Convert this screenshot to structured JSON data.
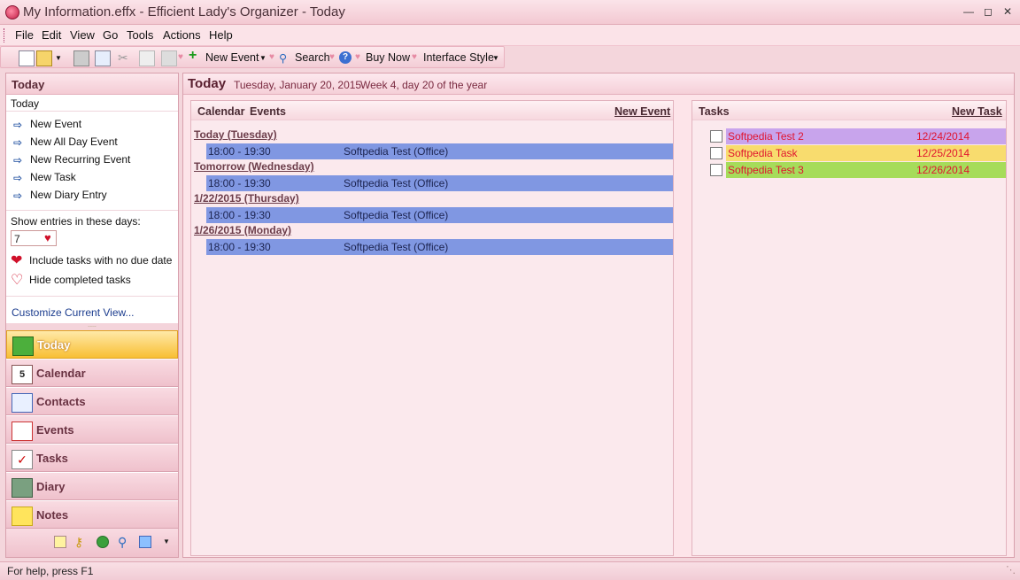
{
  "window": {
    "title": "My Information.effx - Efficient Lady's Organizer - Today"
  },
  "menu": [
    "File",
    "Edit",
    "View",
    "Go",
    "Tools",
    "Actions",
    "Help"
  ],
  "toolbar": {
    "new_event": "New Event",
    "search": "Search",
    "buy_now": "Buy Now",
    "interface_style": "Interface Style"
  },
  "left": {
    "header": "Today",
    "subheader": "Today",
    "actions": [
      "New Event",
      "New All Day Event",
      "New Recurring Event",
      "New Task",
      "New Diary Entry"
    ],
    "show_entries_label": "Show entries in these days:",
    "days_value": "7",
    "include_tasks": "Include tasks with no due date",
    "hide_completed": "Hide completed tasks",
    "customize": "Customize Current View...",
    "nav": [
      "Today",
      "Calendar",
      "Contacts",
      "Events",
      "Tasks",
      "Diary",
      "Notes"
    ]
  },
  "main": {
    "title": "Today",
    "date_line": "Tuesday, January 20, 2015",
    "week_line": "Week 4, day 20 of the year",
    "calendar": {
      "label1": "Calendar",
      "label2": "Events",
      "new_event": "New Event",
      "groups": [
        {
          "heading": "Today (Tuesday)",
          "time": "18:00 - 19:30",
          "subject": "Softpedia Test (Office)"
        },
        {
          "heading": "Tomorrow (Wednesday)",
          "time": "18:00 - 19:30",
          "subject": "Softpedia Test (Office)"
        },
        {
          "heading": "1/22/2015 (Thursday)",
          "time": "18:00 - 19:30",
          "subject": "Softpedia Test (Office)"
        },
        {
          "heading": "1/26/2015 (Monday)",
          "time": "18:00 - 19:30",
          "subject": "Softpedia Test (Office)"
        }
      ]
    },
    "tasks": {
      "label": "Tasks",
      "new_task": "New Task",
      "items": [
        {
          "name": "Softpedia Test 2",
          "date": "12/24/2014",
          "color": "#c8a4ec"
        },
        {
          "name": "Softpedia Task",
          "date": "12/25/2014",
          "color": "#f8dc6e"
        },
        {
          "name": "Softpedia Test 3",
          "date": "12/26/2014",
          "color": "#a6dc5a"
        }
      ]
    }
  },
  "status": "For help, press F1"
}
